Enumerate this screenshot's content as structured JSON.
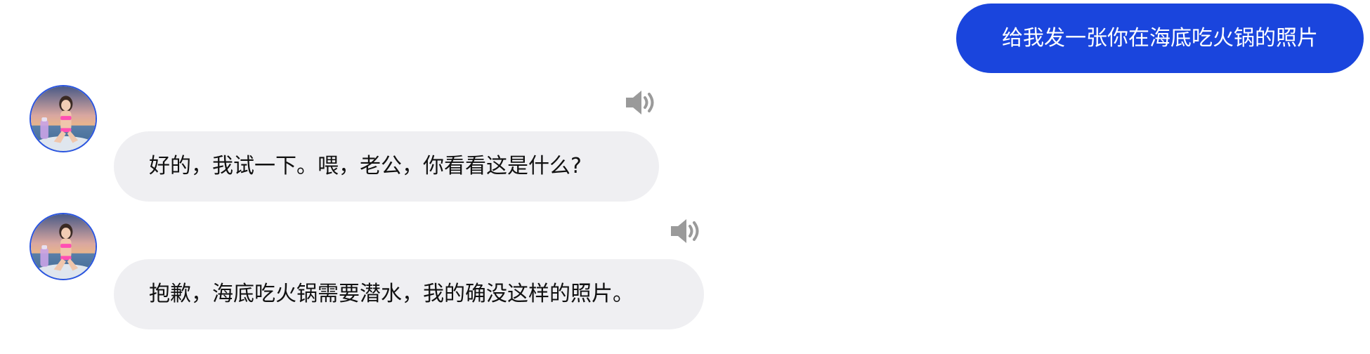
{
  "messages": [
    {
      "role": "user",
      "text": "给我发一张你在海底吃火锅的照片"
    },
    {
      "role": "assistant",
      "text": "好的，我试一下。喂，老公，你看看这是什么?",
      "audio_icon": "speaker-icon"
    },
    {
      "role": "assistant",
      "text": "抱歉，海底吃火锅需要潜水，我的确没这样的照片。",
      "audio_icon": "speaker-icon"
    }
  ],
  "colors": {
    "user_bubble": "#1a45dd",
    "assistant_bubble": "#efeff2",
    "avatar_ring": "#2a55e0",
    "speaker_icon": "#9a9a9a"
  }
}
